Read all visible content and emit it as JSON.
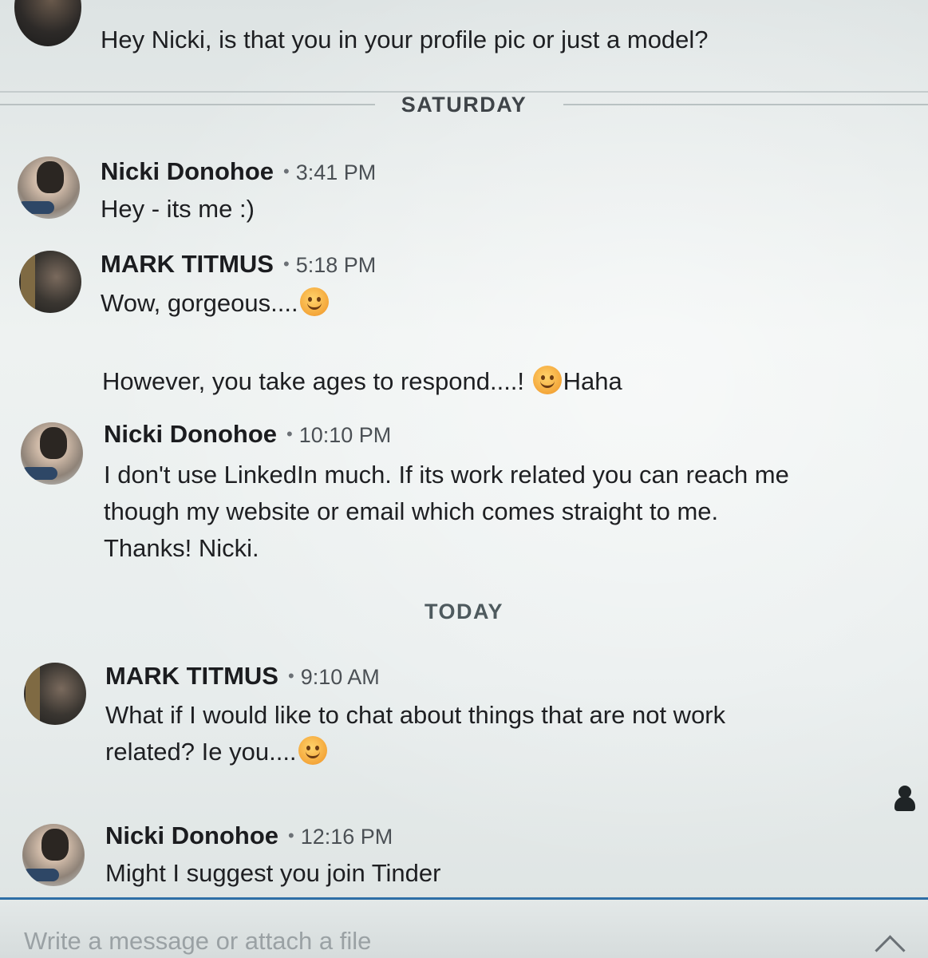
{
  "top_message": {
    "text": "Hey Nicki, is that you in your profile pic or just a model?"
  },
  "day_separators": {
    "saturday": "SATURDAY",
    "today": "TODAY"
  },
  "messages": [
    {
      "sender": "Nicki Donohoe",
      "separator": "•",
      "time": "3:41 PM",
      "lines": [
        "Hey - its me :)"
      ]
    },
    {
      "sender": "MARK TITMUS",
      "separator": "•",
      "time": "5:18 PM",
      "lines": [
        "Wow, gorgeous....",
        "However, you take ages to respond....!",
        "Haha"
      ]
    },
    {
      "sender": "Nicki Donohoe",
      "separator": "•",
      "time": "10:10 PM",
      "lines": [
        "I don't use LinkedIn much. If its work related you can reach me",
        "though my website or email which comes straight to me.",
        "Thanks! Nicki."
      ]
    },
    {
      "sender": "MARK TITMUS",
      "separator": "•",
      "time": "9:10 AM",
      "lines": [
        "What if I would like to chat about things that are not work",
        "related? Ie you...."
      ]
    },
    {
      "sender": "Nicki Donohoe",
      "separator": "•",
      "time": "12:16 PM",
      "lines": [
        "Might I suggest you join Tinder"
      ]
    }
  ],
  "icons": {
    "emoji": "smiling-face-emoji",
    "typing": "typing-indicator-icon",
    "expand": "chevron-up-icon"
  },
  "composer": {
    "placeholder": "Write a message or attach a file"
  }
}
